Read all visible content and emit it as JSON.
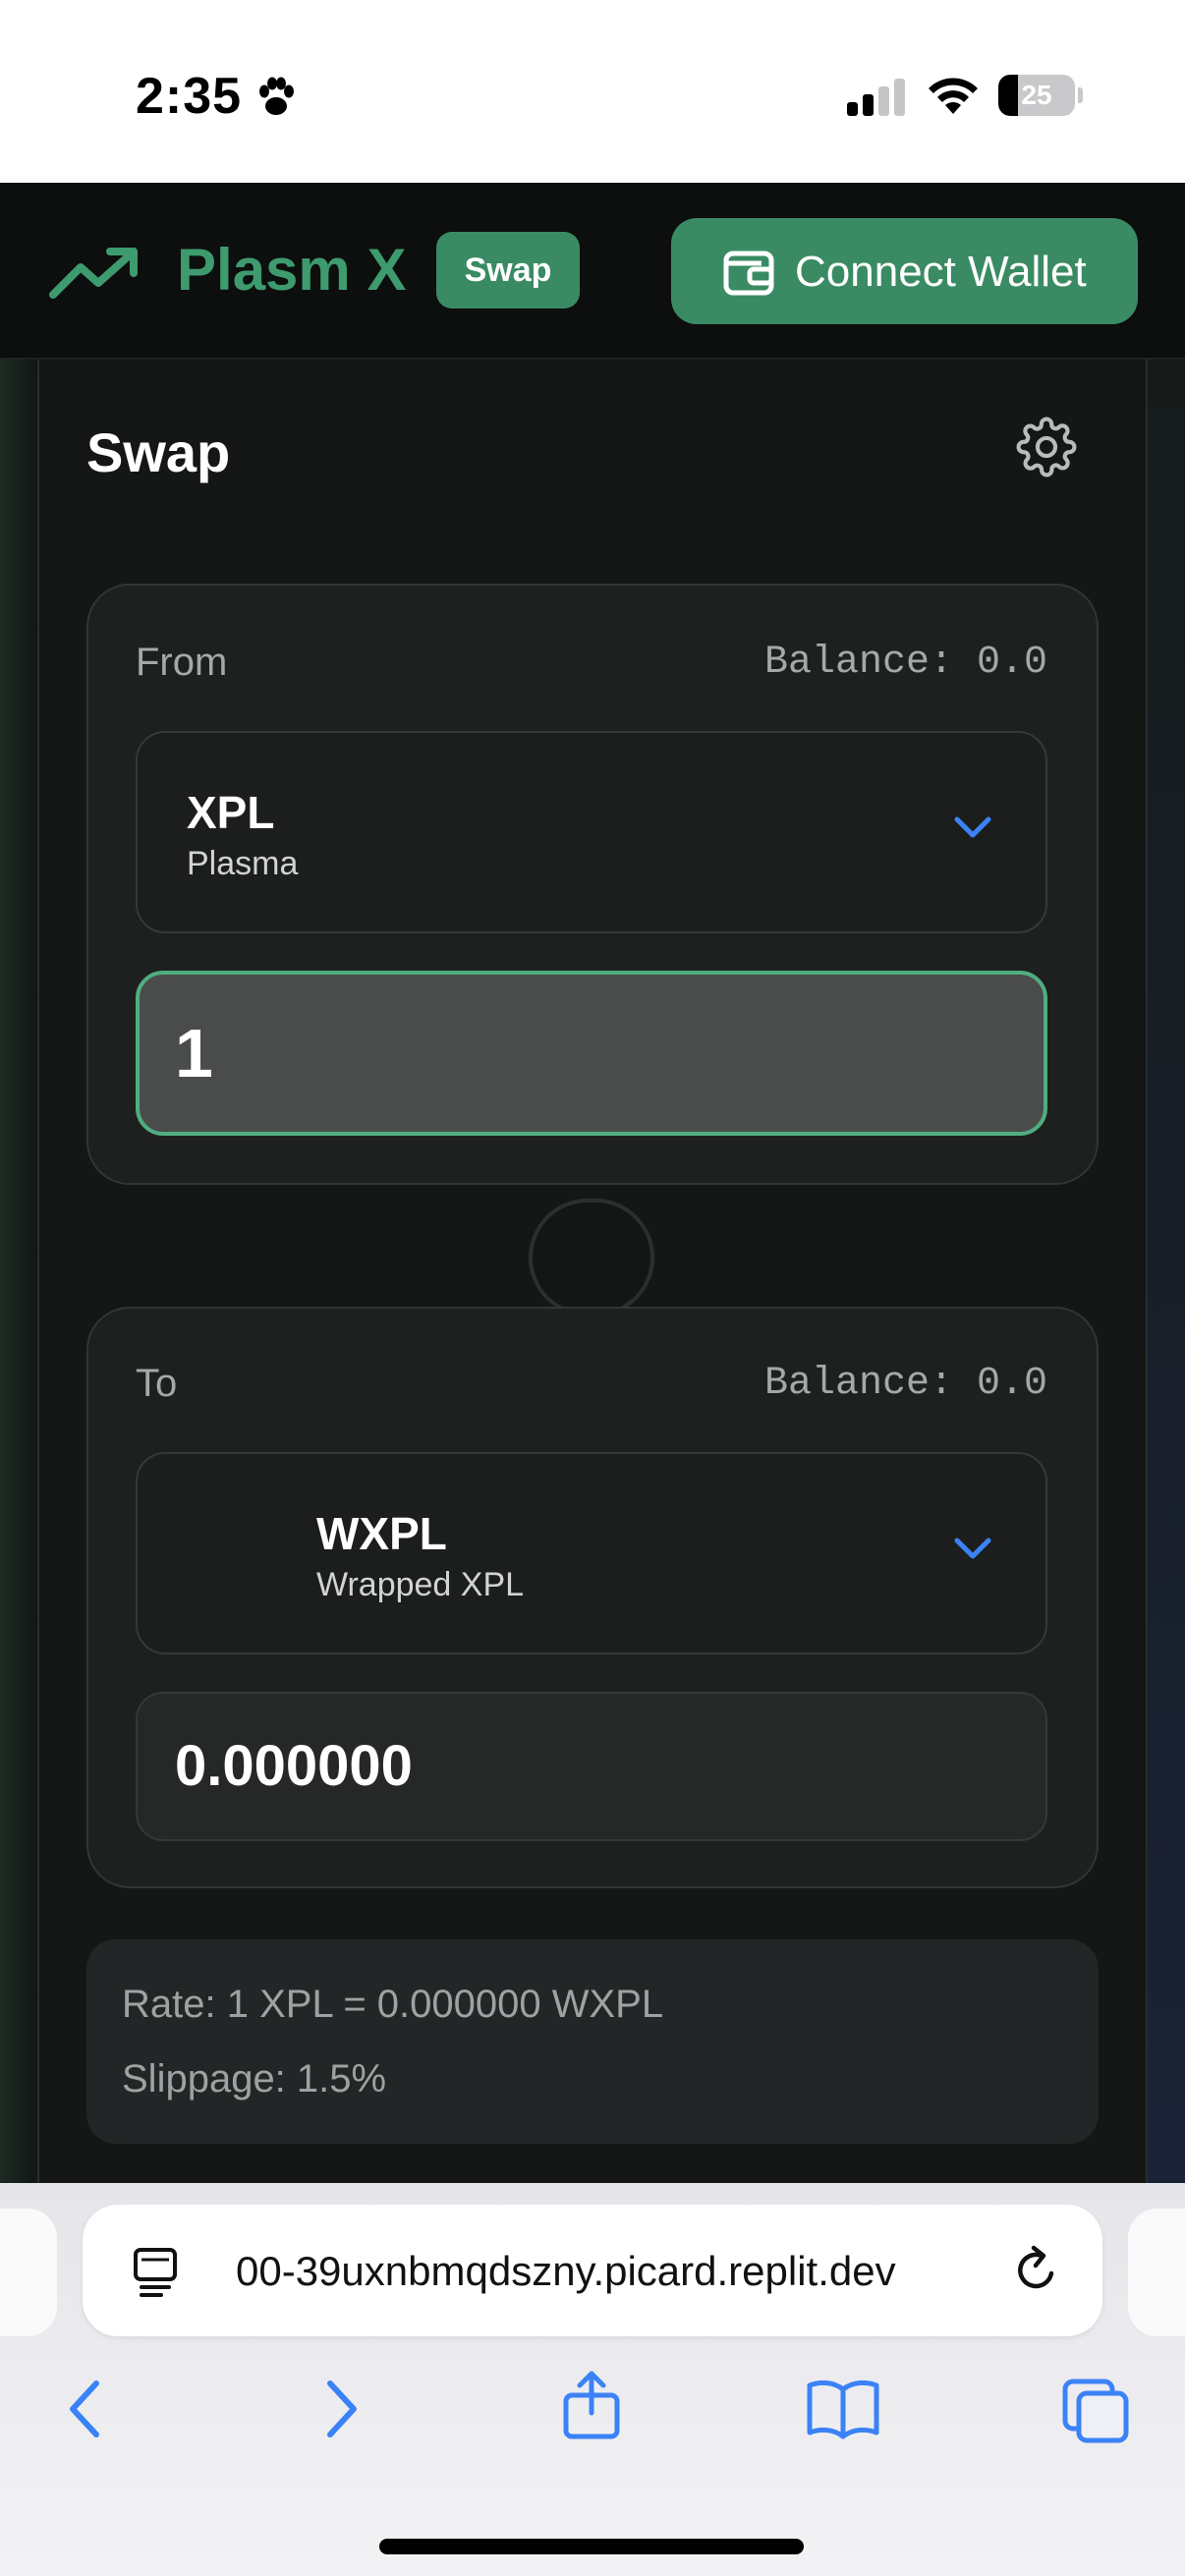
{
  "status_bar": {
    "time": "2:35",
    "battery": "25",
    "battery_level": 0.25
  },
  "header": {
    "brand": "Plasm X",
    "badge": "Swap",
    "connect_label": "Connect Wallet",
    "accent_color": "#3a8b63"
  },
  "swap": {
    "title": "Swap",
    "from": {
      "label": "From",
      "balance": "Balance: 0.0",
      "token_symbol": "XPL",
      "token_name": "Plasma",
      "amount": "1"
    },
    "to": {
      "label": "To",
      "balance": "Balance: 0.0",
      "token_symbol": "WXPL",
      "token_name": "Wrapped XPL",
      "amount": "0.000000"
    },
    "rate": "Rate: 1 XPL = 0.000000 WXPL",
    "slippage": "Slippage: 1.5%"
  },
  "browser": {
    "url": "00-39uxnbmqdszny.picard.replit.dev"
  },
  "icons": {
    "status": [
      "paw-icon",
      "cellular-signal-icon",
      "wifi-icon",
      "battery-icon"
    ],
    "header": [
      "trending-up-icon",
      "wallet-icon"
    ],
    "swap": [
      "gear-icon",
      "chevron-down-icon"
    ],
    "browser": [
      "page-icon",
      "reload-icon",
      "back-icon",
      "forward-icon",
      "share-icon",
      "bookmarks-icon",
      "tabs-icon"
    ]
  }
}
